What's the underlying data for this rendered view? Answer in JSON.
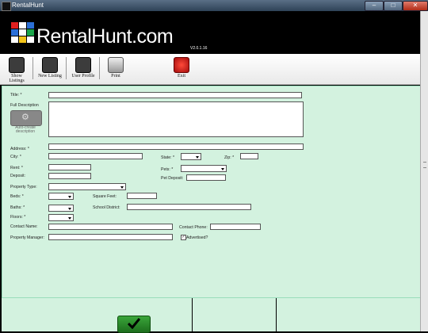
{
  "window": {
    "title": "RentalHunt"
  },
  "header": {
    "logo_text": "RentalHunt.com",
    "version": "V2.0.1.16"
  },
  "toolbar": {
    "show_listings": "Show Listings",
    "new_listing": "New Listing",
    "user_profile": "User Profile",
    "print": "Print",
    "exit": "Exit"
  },
  "form": {
    "title_label": "Title: *",
    "title_value": "",
    "full_description_label": "Full Description",
    "full_description_value": "",
    "auto_create_label": "Auto-create description",
    "address_label": "Address: *",
    "city_label": "City: *",
    "state_label": "State: *",
    "zip_label": "Zip: *",
    "rent_label": "Rent: *",
    "deposit_label": "Deposit:",
    "pets_label": "Pets: *",
    "pet_deposit_label": "Pet Deposit:",
    "property_type_label": "Property Type:",
    "beds_label": "Beds: *",
    "square_feet_label": "Square Feet:",
    "baths_label": "Baths: *",
    "school_district_label": "School District:",
    "floors_label": "Floors: *",
    "contact_name_label": "Contact Name:",
    "contact_phone_label": "Contact Phone:",
    "property_manager_label": "Property Manager:",
    "advertised_label": "Advertised?",
    "advertised_checked": "✓"
  },
  "colors": {
    "form_bg": "#d3f2df",
    "header_bg": "#000000",
    "ok_green": "#2a8c2a",
    "exit_red": "#d11212"
  }
}
